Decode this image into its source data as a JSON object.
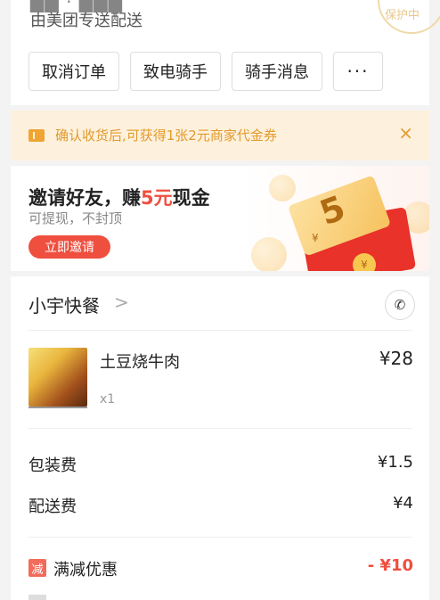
{
  "header": {
    "delivery_note": "由美团专送配送",
    "stamp_text": "保护中"
  },
  "actions": {
    "cancel": "取消订单",
    "call_rider": "致电骑手",
    "rider_message": "骑手消息",
    "more": "···"
  },
  "coupon_notice": {
    "text": "确认收货后,可获得1张2元商家代金券",
    "close": "×"
  },
  "invite_banner": {
    "title_prefix": "邀请好友，赚",
    "title_amount": "5元",
    "title_suffix": "现金",
    "subtitle": "可提现，不封顶",
    "button": "立即邀请",
    "ticket_value": "5",
    "ticket_currency": "¥",
    "coin_symbol": "¥"
  },
  "order": {
    "shop_name": "小宇快餐",
    "shop_chevron": ">",
    "items": [
      {
        "name": "土豆烧牛肉",
        "qty": "x1",
        "price": "¥28"
      }
    ],
    "fees": [
      {
        "label": "包装费",
        "value": "¥1.5"
      },
      {
        "label": "配送费",
        "value": "¥4"
      }
    ],
    "discount": {
      "tag": "减",
      "label": "满减优惠",
      "value": "- ¥10"
    }
  },
  "colors": {
    "accent_red": "#ef4f3f",
    "coupon_bg": "#fdf1dd",
    "coupon_text": "#e39a2c"
  }
}
